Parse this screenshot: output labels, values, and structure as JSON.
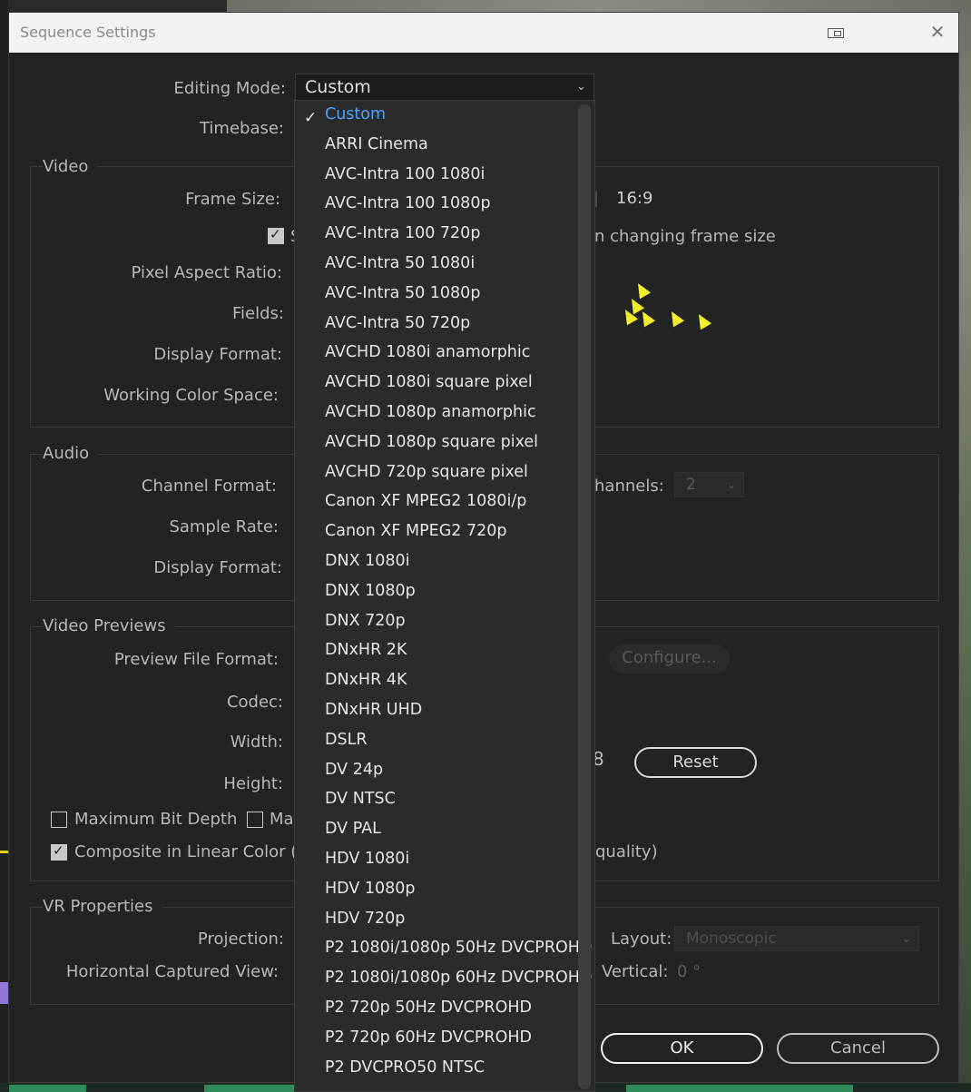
{
  "dialog": {
    "title": "Sequence Settings",
    "close_glyph": "✕"
  },
  "editing_mode": {
    "label": "Editing Mode:",
    "value": "Custom"
  },
  "timebase": {
    "label": "Timebase:"
  },
  "video": {
    "title": "Video",
    "frame_size_label": "Frame Size:",
    "aspect": "16:9",
    "scale_partial": "S",
    "scale_tail": "n changing frame size",
    "pixel_aspect_label": "Pixel Aspect Ratio:",
    "fields_label": "Fields:",
    "display_format_label": "Display Format:",
    "working_color_label": "Working Color Space:"
  },
  "audio": {
    "title": "Audio",
    "channel_format_label": "Channel Format:",
    "channels_label": "hannels:",
    "channels_value": "2",
    "sample_rate_label": "Sample Rate:",
    "display_format_label": "Display Format:"
  },
  "previews": {
    "title": "Video Previews",
    "file_format_label": "Preview File Format:",
    "configure_label": "Configure...",
    "codec_label": "Codec:",
    "width_label": "Width:",
    "height_label": "Height:",
    "link_glyph": "8",
    "reset_label": "Reset",
    "max_bit_depth_label": "Maximum Bit Depth",
    "max_partial": "Ma",
    "composite_label": "Composite in Linear Color (re",
    "quality_tail": "quality)"
  },
  "vr": {
    "title": "VR Properties",
    "projection_label": "Projection:",
    "layout_label": "Layout:",
    "layout_value": "Monoscopic",
    "horizontal_label": "Horizontal Captured View:",
    "vertical_label": "Vertical:",
    "vertical_value": "0 °"
  },
  "buttons": {
    "ok": "OK",
    "cancel": "Cancel"
  },
  "dropdown": {
    "check_glyph": "✓",
    "selected": "Custom",
    "items": [
      "Custom",
      "ARRI Cinema",
      "AVC-Intra 100 1080i",
      "AVC-Intra 100 1080p",
      "AVC-Intra 100 720p",
      "AVC-Intra 50 1080i",
      "AVC-Intra 50 1080p",
      "AVC-Intra 50 720p",
      "AVCHD 1080i anamorphic",
      "AVCHD 1080i square pixel",
      "AVCHD 1080p anamorphic",
      "AVCHD 1080p square pixel",
      "AVCHD 720p square pixel",
      "Canon XF MPEG2 1080i/p",
      "Canon XF MPEG2 720p",
      "DNX 1080i",
      "DNX 1080p",
      "DNX 720p",
      "DNxHR 2K",
      "DNxHR 4K",
      "DNxHR UHD",
      "DSLR",
      "DV 24p",
      "DV NTSC",
      "DV PAL",
      "HDV 1080i",
      "HDV 1080p",
      "HDV 720p",
      "P2 1080i/1080p 50Hz DVCPROHD",
      "P2 1080i/1080p 60Hz DVCPROHD",
      "P2 720p 50Hz DVCPROHD",
      "P2 720p 60Hz DVCPROHD",
      "P2 DVCPRO50 NTSC"
    ]
  }
}
